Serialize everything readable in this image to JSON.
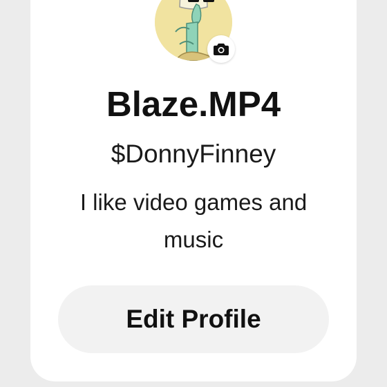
{
  "profile": {
    "display_name": "Blaze.MP4",
    "cashtag": "$DonnyFinney",
    "bio": "I like video games and music",
    "edit_button_label": "Edit Profile"
  },
  "icons": {
    "camera": "camera-icon",
    "avatar": "avatar-image"
  },
  "colors": {
    "card_background": "#ffffff",
    "page_background": "#ececec",
    "button_background": "#f2f2f2",
    "text_primary": "#111111",
    "avatar_background": "#f1e3a0"
  }
}
